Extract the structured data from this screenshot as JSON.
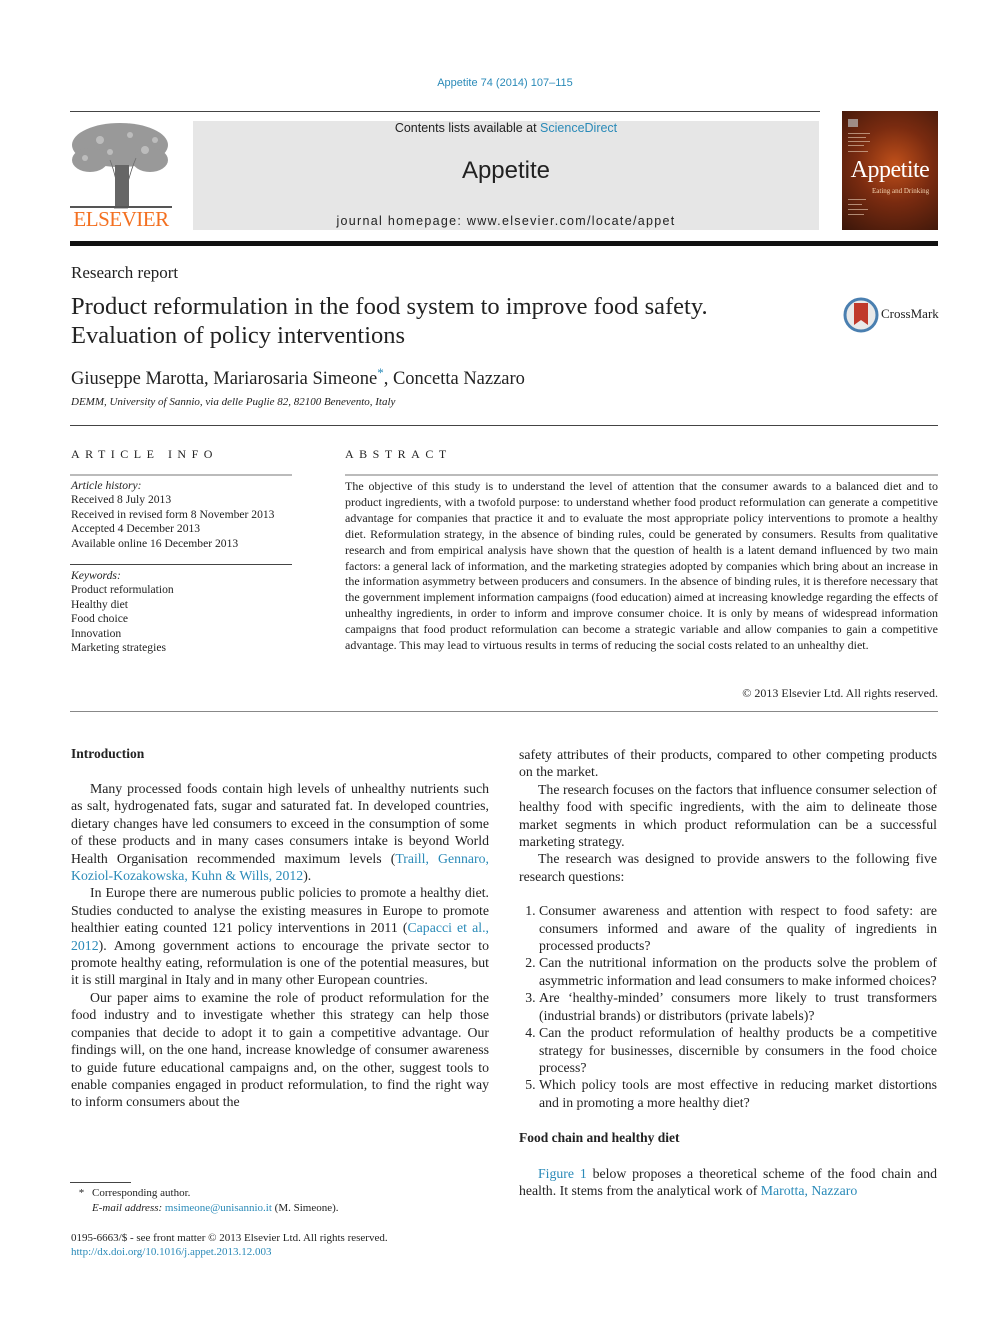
{
  "header": {
    "citation": "Appetite 74 (2014) 107–115",
    "contents_prefix": "Contents lists available at ",
    "contents_link": "ScienceDirect",
    "journal_name": "Appetite",
    "homepage": "journal homepage: www.elsevier.com/locate/appet",
    "publisher_logo_text": "ELSEVIER",
    "cover_title": "Appetite",
    "cover_subtitle": "Eating and Drinking",
    "colors": {
      "link": "#2a8ab8",
      "elsevier_orange": "#f37021",
      "box_bg": "#e6e6e6"
    }
  },
  "article": {
    "type": "Research report",
    "title": "Product reformulation in the food system to improve food safety. Evaluation of policy interventions",
    "crossmark_label": "CrossMark",
    "authors_part1": "Giuseppe Marotta, Mariarosaria Simeone",
    "authors_mark": "*",
    "authors_part2": ", Concetta Nazzaro",
    "affiliation": "DEMM, University of Sannio, via delle Puglie 82, 82100 Benevento, Italy"
  },
  "article_info": {
    "heading": "ARTICLE INFO",
    "history_label": "Article history:",
    "history": [
      "Received 8 July 2013",
      "Received in revised form 8 November 2013",
      "Accepted 4 December 2013",
      "Available online 16 December 2013"
    ],
    "keywords_label": "Keywords:",
    "keywords": [
      "Product reformulation",
      "Healthy diet",
      "Food choice",
      "Innovation",
      "Marketing strategies"
    ]
  },
  "abstract": {
    "heading": "ABSTRACT",
    "text": "The objective of this study is to understand the level of attention that the consumer awards to a balanced diet and to product ingredients, with a twofold purpose: to understand whether food product reformulation can generate a competitive advantage for companies that practice it and to evaluate the most appropriate policy interventions to promote a healthy diet. Reformulation strategy, in the absence of binding rules, could be generated by consumers. Results from qualitative research and from empirical analysis have shown that the question of health is a latent demand influenced by two main factors: a general lack of information, and the marketing strategies adopted by companies which bring about an increase in the information asymmetry between producers and consumers. In the absence of binding rules, it is therefore necessary that the government implement information campaigns (food education) aimed at increasing knowledge regarding the effects of unhealthy ingredients, in order to inform and improve consumer choice. It is only by means of widespread information campaigns that food product reformulation can become a strategic variable and allow companies to gain a competitive advantage. This may lead to virtuous results in terms of reducing the social costs related to an unhealthy diet.",
    "copyright": "© 2013 Elsevier Ltd. All rights reserved."
  },
  "body": {
    "intro_heading": "Introduction",
    "p1_text": "Many processed foods contain high levels of unhealthy nutrients such as salt, hydrogenated fats, sugar and saturated fat. In developed countries, dietary changes have led consumers to exceed in the consumption of some of these products and in many cases consumers intake is beyond World Health Organisation recommended maximum levels (",
    "p1_link": "Traill, Gennaro, Koziol-Kozakowska, Kuhn & Wills, 2012",
    "p1_end": ").",
    "p2_text": "In Europe there are numerous public policies to promote a healthy diet. Studies conducted to analyse the existing measures in Europe to promote healthier eating counted 121 policy interventions in 2011 (",
    "p2_link": "Capacci et al., 2012",
    "p2_end": "). Among government actions to encourage the private sector to promote healthy eating, reformulation is one of the potential measures, but it is still marginal in Italy and in many other European countries.",
    "p3_text": "Our paper aims to examine the role of product reformulation for the food industry and to investigate whether this strategy can help those companies that decide to adopt it to gain a competitive advantage. Our findings will, on the one hand, increase knowledge of consumer awareness to guide future educational campaigns and, on the other, suggest tools to enable companies engaged in product reformulation, to find the right way to inform consumers about the",
    "p4_text": "safety attributes of their products, compared to other competing products on the market.",
    "p5_text": "The research focuses on the factors that influence consumer selection of healthy food with specific ingredients, with the aim to delineate those market segments in which product reformulation can be a successful marketing strategy.",
    "p6_text": "The research was designed to provide answers to the following five research questions:",
    "questions": [
      "Consumer awareness and attention with respect to food safety: are consumers informed and aware of the quality of ingredients in processed products?",
      "Can the nutritional information on the products solve the problem of asymmetric information and lead consumers to make informed choices?",
      "Are ‘healthy-minded’ consumers more likely to trust transformers (industrial brands) or distributors (private labels)?",
      "Can the product reformulation of healthy products be a competitive strategy for businesses, discernible by consumers in the food choice process?",
      "Which policy tools are most effective in reducing market distortions and in promoting a more healthy diet?"
    ],
    "food_heading": "Food chain and healthy diet",
    "p7_link": "Figure 1",
    "p7_text": " below proposes a theoretical scheme of the food chain and health. It stems from the analytical work of ",
    "p7_link2": "Marotta, Nazzaro"
  },
  "footnotes": {
    "mark": "*",
    "corresponding": "Corresponding author.",
    "email_label": "E-mail address:",
    "email": "msimeone@unisannio.it",
    "email_suffix": " (M. Simeone).",
    "issn_line": "0195-6663/$ - see front matter © 2013 Elsevier Ltd. All rights reserved.",
    "doi": "http://dx.doi.org/10.1016/j.appet.2013.12.003"
  }
}
